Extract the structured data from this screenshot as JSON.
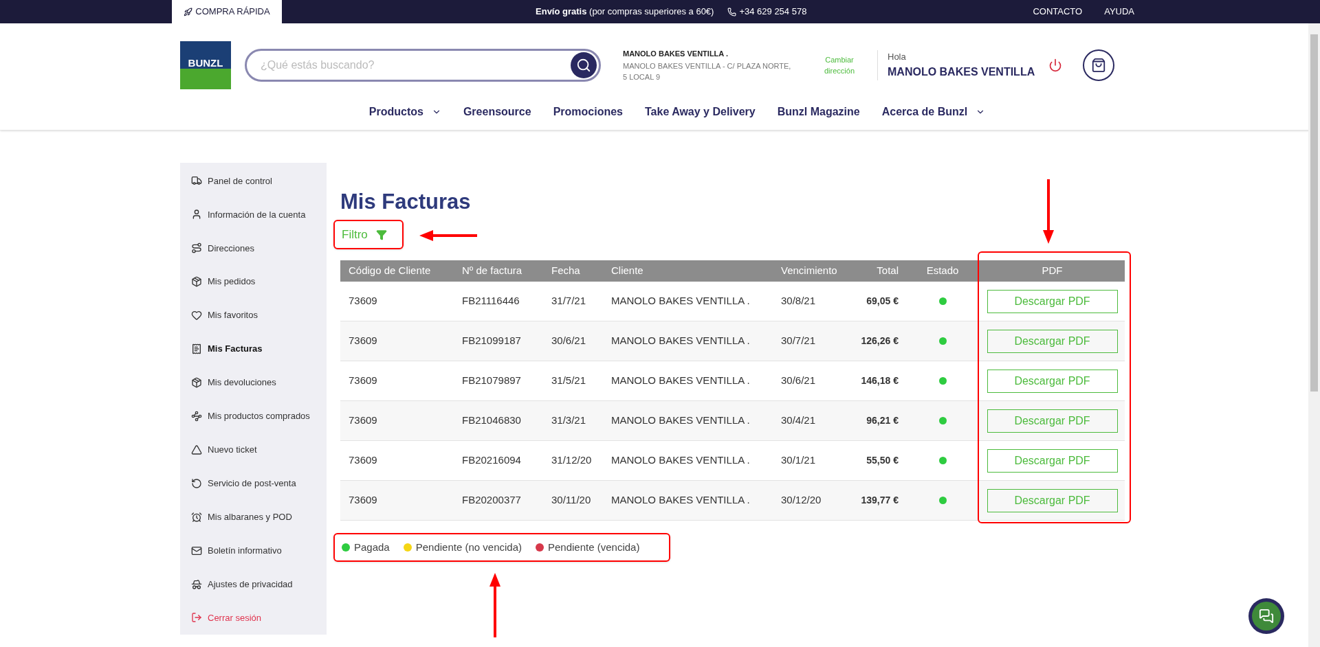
{
  "top_bar": {
    "quick_buy": "COMPRA RÁPIDA",
    "shipping_bold": "Envío gratis",
    "shipping_rest": "(por compras superiores a 60€)",
    "phone": "+34 629 254 578",
    "links": [
      "CONTACTO",
      "AYUDA"
    ]
  },
  "header": {
    "logo": "BUNZL",
    "search": {
      "placeholder": "¿Qué estás buscando?"
    },
    "address": {
      "name": "MANOLO BAKES VENTILLA .",
      "line": "MANOLO BAKES VENTILLA - C/ PLAZA NORTE, 5 LOCAL 9"
    },
    "change_address": "Cambiar dirección",
    "greeting": "Hola",
    "user": "MANOLO BAKES VENTILLA"
  },
  "nav": [
    {
      "label": "Productos",
      "dropdown": true
    },
    {
      "label": "Greensource",
      "dropdown": false
    },
    {
      "label": "Promociones",
      "dropdown": false
    },
    {
      "label": "Take Away y Delivery",
      "dropdown": false
    },
    {
      "label": "Bunzl Magazine",
      "dropdown": false
    },
    {
      "label": "Acerca de Bunzl",
      "dropdown": true
    }
  ],
  "sidebar": {
    "items": [
      {
        "label": "Panel de control",
        "kind": "link",
        "selected": false
      },
      {
        "label": "Información de la cuenta",
        "kind": "link",
        "selected": false
      },
      {
        "label": "Direcciones",
        "kind": "link",
        "selected": false
      },
      {
        "label": "Mis pedidos",
        "kind": "link",
        "selected": false
      },
      {
        "label": "Mis favoritos",
        "kind": "link",
        "selected": false
      },
      {
        "label": "Mis Facturas",
        "kind": "link",
        "selected": true
      },
      {
        "label": "Mis devoluciones",
        "kind": "link",
        "selected": false
      },
      {
        "label": "Mis productos comprados",
        "kind": "link",
        "selected": false
      },
      {
        "label": "Nuevo ticket",
        "kind": "link",
        "selected": false
      },
      {
        "label": "Servicio de post-venta",
        "kind": "link",
        "selected": false
      },
      {
        "label": "Mis albaranes y POD",
        "kind": "link",
        "selected": false
      },
      {
        "label": "Boletín informativo",
        "kind": "link",
        "selected": false
      },
      {
        "label": "Ajustes de privacidad",
        "kind": "link",
        "selected": false
      },
      {
        "label": "Cerrar sesión",
        "kind": "logout",
        "selected": false
      }
    ]
  },
  "page_title": "Mis Facturas",
  "filter": {
    "label": "Filtro"
  },
  "table": {
    "columns": [
      "Código de Cliente",
      "Nº de factura",
      "Fecha",
      "Cliente",
      "Vencimiento",
      "Total",
      "Estado",
      "PDF"
    ],
    "rows": [
      {
        "client_code": "73609",
        "invoice": "FB21116446",
        "date": "31/7/21",
        "client": "MANOLO BAKES VENTILLA .",
        "due": "30/8/21",
        "total": "69,05 €",
        "color": "#2ecc40",
        "pdf": "Descargar PDF"
      },
      {
        "client_code": "73609",
        "invoice": "FB21099187",
        "date": "30/6/21",
        "client": "MANOLO BAKES VENTILLA .",
        "due": "30/7/21",
        "total": "126,26 €",
        "color": "#2ecc40",
        "pdf": "Descargar PDF"
      },
      {
        "client_code": "73609",
        "invoice": "FB21079897",
        "date": "31/5/21",
        "client": "MANOLO BAKES VENTILLA .",
        "due": "30/6/21",
        "total": "146,18 €",
        "color": "#2ecc40",
        "pdf": "Descargar PDF"
      },
      {
        "client_code": "73609",
        "invoice": "FB21046830",
        "date": "31/3/21",
        "client": "MANOLO BAKES VENTILLA .",
        "due": "30/4/21",
        "total": "96,21 €",
        "color": "#2ecc40",
        "pdf": "Descargar PDF"
      },
      {
        "client_code": "73609",
        "invoice": "FB20216094",
        "date": "31/12/20",
        "client": "MANOLO BAKES VENTILLA .",
        "due": "30/1/21",
        "total": "55,50 €",
        "color": "#2ecc40",
        "pdf": "Descargar PDF"
      },
      {
        "client_code": "73609",
        "invoice": "FB20200377",
        "date": "30/11/20",
        "client": "MANOLO BAKES VENTILLA .",
        "due": "30/12/20",
        "total": "139,77 €",
        "color": "#2ecc40",
        "pdf": "Descargar PDF"
      }
    ]
  },
  "legend": [
    {
      "label": "Pagada",
      "color": "#2ecc40"
    },
    {
      "label": "Pendiente (no vencida)",
      "color": "#f5d614"
    },
    {
      "label": "Pendiente (vencida)",
      "color": "#d6384a"
    }
  ]
}
